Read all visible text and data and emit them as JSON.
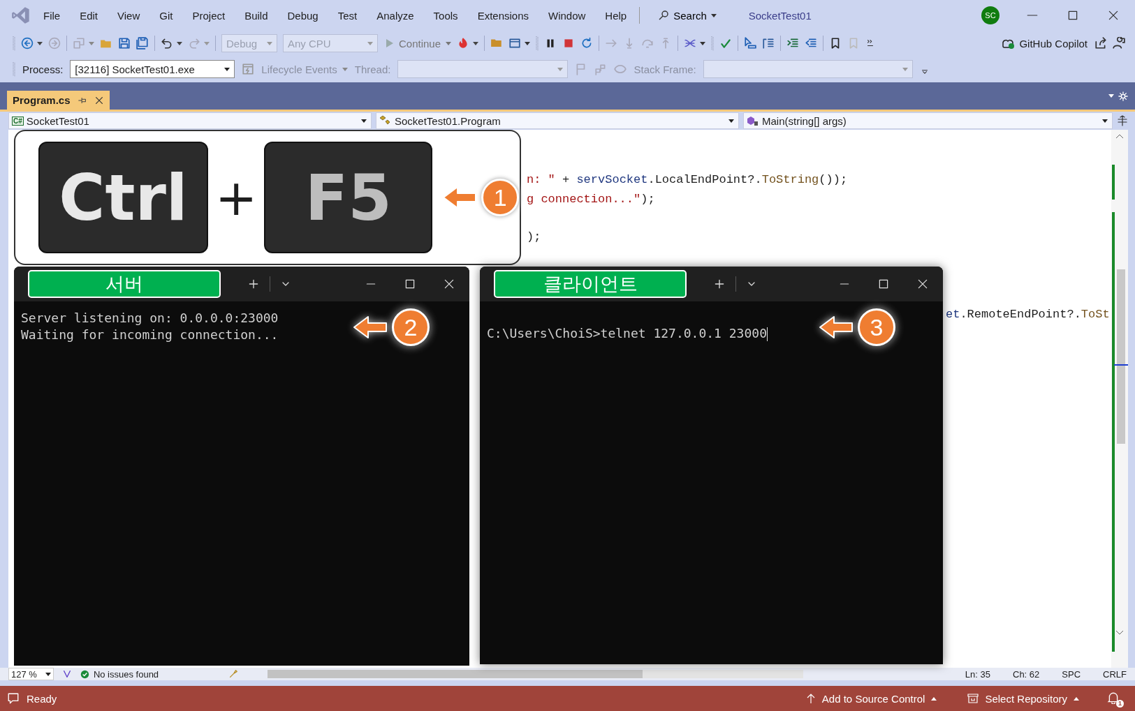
{
  "window": {
    "title": "SocketTest01",
    "avatar": "SC"
  },
  "menu": [
    "File",
    "Edit",
    "View",
    "Git",
    "Project",
    "Build",
    "Debug",
    "Test",
    "Analyze",
    "Tools",
    "Extensions",
    "Window",
    "Help"
  ],
  "search": {
    "label": "Search"
  },
  "toolbar": {
    "configuration": "Debug",
    "platform": "Any CPU",
    "continue": "Continue",
    "copilot": "GitHub Copilot"
  },
  "debug_location": {
    "process_label": "Process:",
    "process": "[32116] SocketTest01.exe",
    "lifecycle": "Lifecycle Events",
    "thread_label": "Thread:",
    "stack_frame_label": "Stack Frame:"
  },
  "tabs": [
    {
      "label": "Program.cs",
      "selected": true
    }
  ],
  "navigation": {
    "project_badge": "C#",
    "project": "SocketTest01",
    "type": "SocketTest01.Program",
    "member": "Main(string[] args)"
  },
  "code_upper": [
    {
      "segments": [
        {
          "kind": "string",
          "text": "n: \""
        },
        {
          "kind": "plain",
          "text": " + "
        },
        {
          "kind": "ident",
          "text": "servSocket"
        },
        {
          "kind": "plain",
          "text": ".LocalEndPoint?."
        },
        {
          "kind": "method",
          "text": "ToString"
        },
        {
          "kind": "plain",
          "text": "());"
        }
      ]
    },
    {
      "segments": [
        {
          "kind": "string",
          "text": "g connection...\""
        },
        {
          "kind": "plain",
          "text": ");"
        }
      ]
    },
    {
      "segments": [
        {
          "kind": "plain",
          "text": ");"
        }
      ]
    }
  ],
  "code_right": [
    {
      "segments": [
        {
          "kind": "ident",
          "text": "et"
        },
        {
          "kind": "plain",
          "text": ".RemoteEndPoint?."
        },
        {
          "kind": "method",
          "text": "ToSt"
        }
      ]
    }
  ],
  "editor_status": {
    "zoom": "127 %",
    "issues": "No issues found",
    "line": "Ln: 35",
    "column": "Ch: 62",
    "whitespace": "SPC",
    "line_ending": "CRLF"
  },
  "status_bar": {
    "state": "Ready",
    "source_control": "Add to Source Control",
    "repository": "Select Repository",
    "notifications": "1"
  },
  "shortcut": {
    "keys": [
      "Ctrl",
      "F5"
    ],
    "joiner": "+",
    "step": "1"
  },
  "terminals": [
    {
      "tab": "서버",
      "lines": [
        "Server listening on: 0.0.0.0:23000",
        "Waiting for incoming connection..."
      ],
      "cursor": false,
      "step": "2"
    },
    {
      "tab": "클라이언트",
      "lines": [
        "C:\\Users\\ChoiS>telnet 127.0.0.1 23000"
      ],
      "cursor": true,
      "step": "3"
    }
  ]
}
